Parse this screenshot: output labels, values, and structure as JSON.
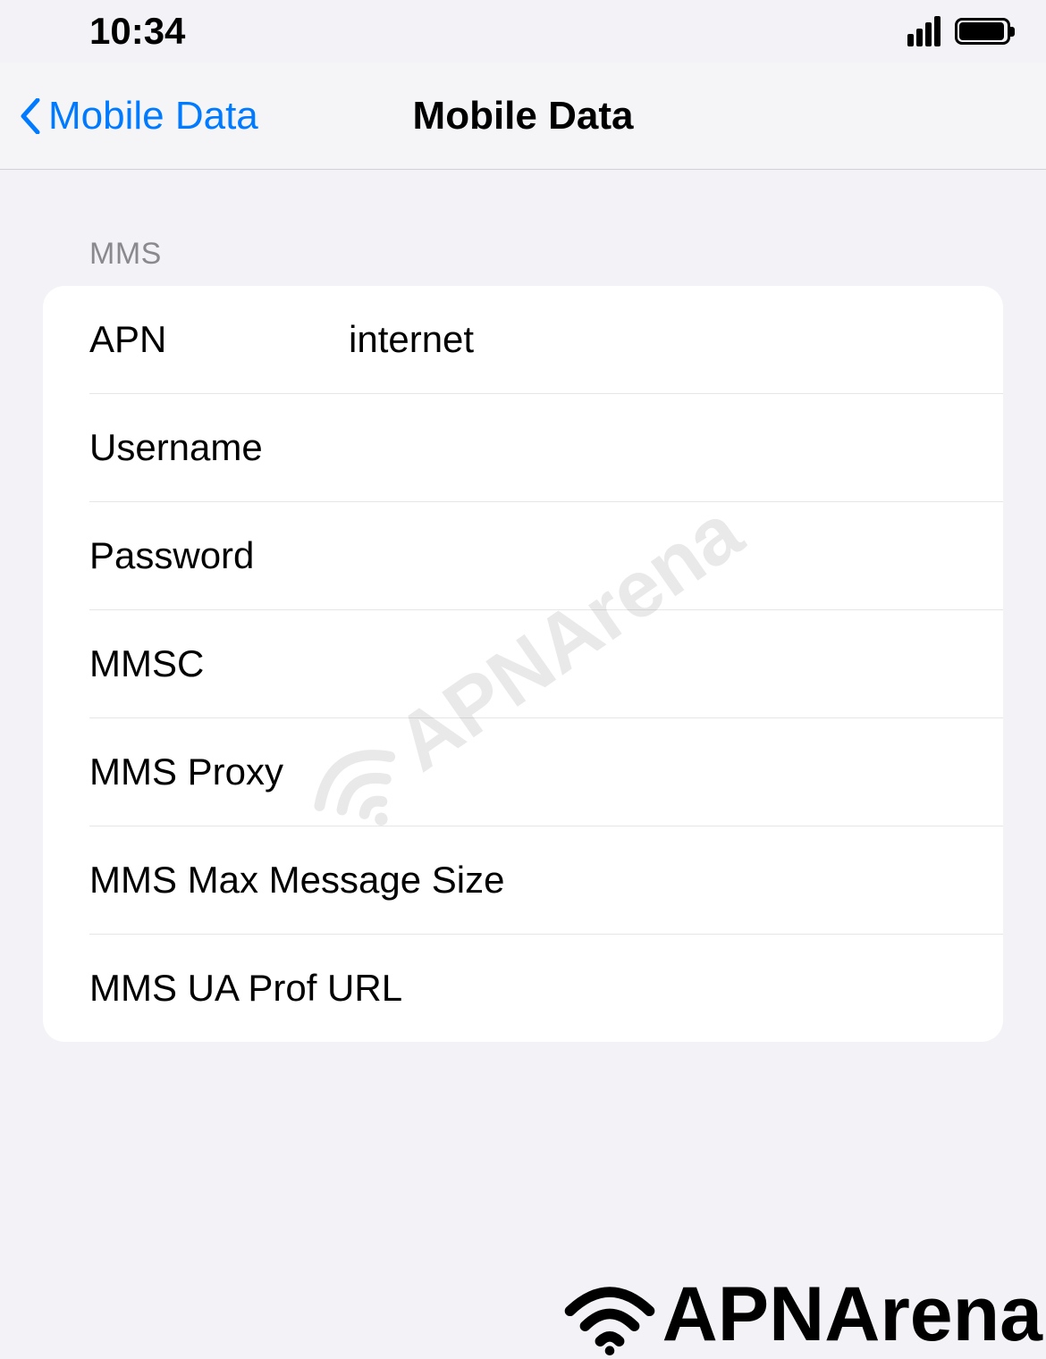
{
  "statusBar": {
    "time": "10:34"
  },
  "navBar": {
    "backLabel": "Mobile Data",
    "title": "Mobile Data"
  },
  "section": {
    "header": "MMS",
    "rows": {
      "apn": {
        "label": "APN",
        "value": "internet"
      },
      "username": {
        "label": "Username",
        "value": ""
      },
      "password": {
        "label": "Password",
        "value": ""
      },
      "mmsc": {
        "label": "MMSC",
        "value": ""
      },
      "mmsProxy": {
        "label": "MMS Proxy",
        "value": ""
      },
      "mmsMax": {
        "label": "MMS Max Message Size",
        "value": ""
      },
      "mmsUa": {
        "label": "MMS UA Prof URL",
        "value": ""
      }
    }
  },
  "watermark": {
    "text": "APNArena"
  }
}
